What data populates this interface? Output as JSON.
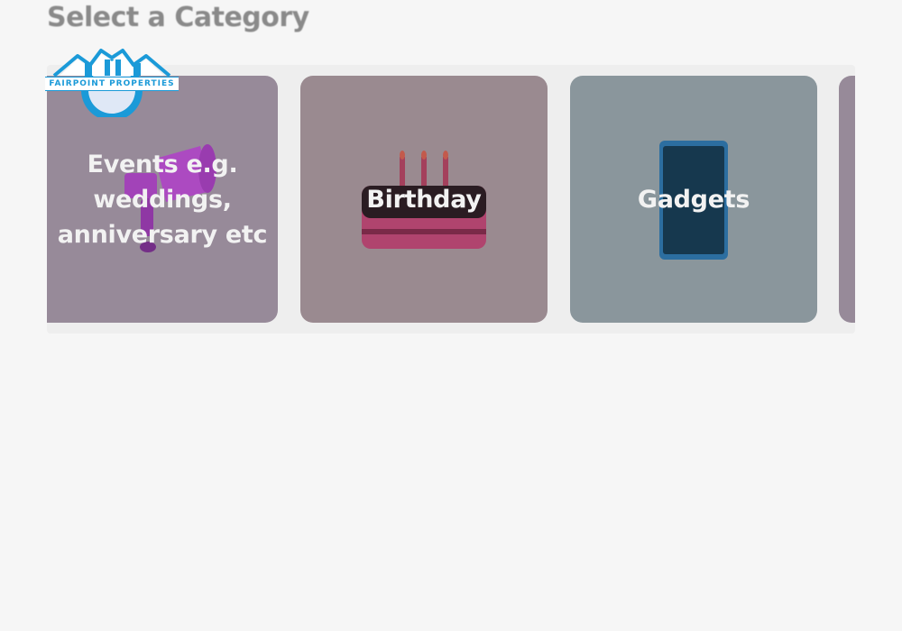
{
  "section": {
    "title": "Select a Category"
  },
  "brand": {
    "name": "FAIRPOINT PROPERTIES",
    "icon": "house-roofs-logo",
    "color": "#1b9ad8"
  },
  "categories": [
    {
      "label": "Events e.g. weddings, anniversary etc",
      "icon": "megaphone-icon",
      "bg": "#978a99"
    },
    {
      "label": "Birthday",
      "icon": "birthday-cake-icon",
      "bg": "#9a8a90"
    },
    {
      "label": "Gadgets",
      "icon": "smartphone-icon",
      "bg": "#8a969c"
    }
  ]
}
